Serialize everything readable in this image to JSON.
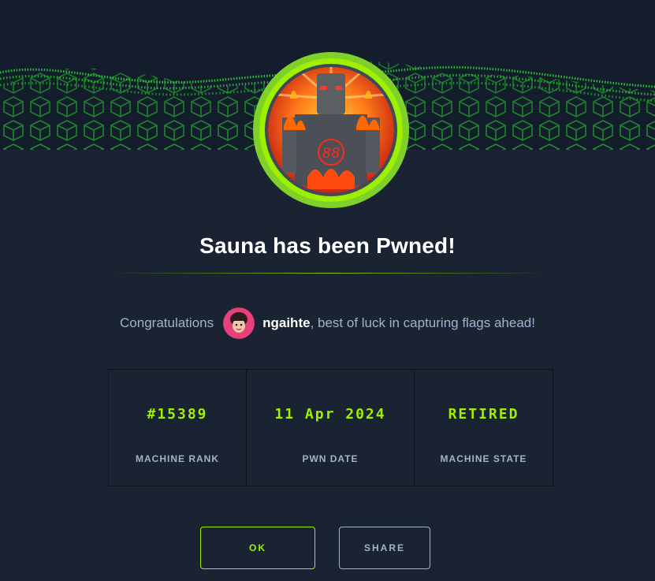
{
  "title": "Sauna has been Pwned!",
  "congrats": {
    "prefix": "Congratulations",
    "username": "ngaihte",
    "suffix": ", best of luck in capturing flags ahead!"
  },
  "stats": [
    {
      "value": "#15389",
      "label": "MACHINE RANK"
    },
    {
      "value": "11 Apr 2024",
      "label": "PWN DATE"
    },
    {
      "value": "RETIRED",
      "label": "MACHINE STATE"
    }
  ],
  "buttons": {
    "ok": "OK",
    "share": "SHARE"
  },
  "colors": {
    "background": "#1a2332",
    "accent": "#9fef00",
    "muted_text": "#a4b1cd"
  },
  "icons": {
    "badge": "machine-badge-icon",
    "avatar": "user-avatar-icon"
  }
}
